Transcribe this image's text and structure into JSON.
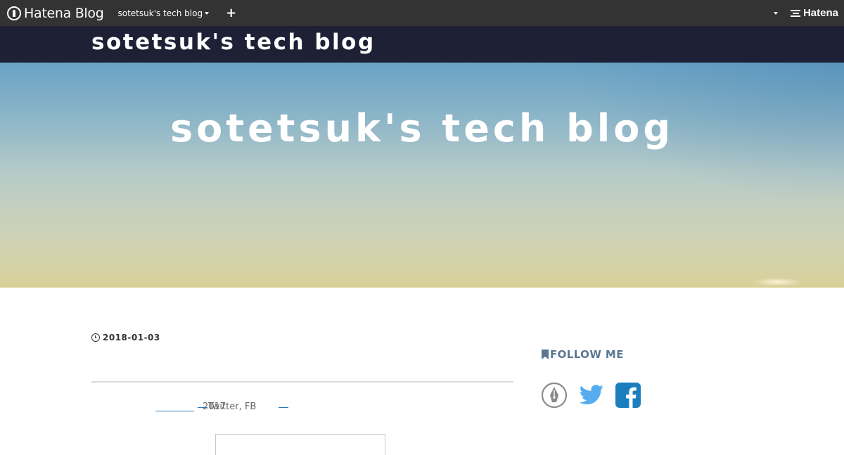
{
  "globalbar": {
    "logo_text": "Hatena Blog",
    "blog_name": "sotetsuk's tech blog",
    "add_label": "+",
    "brand": "Hatena"
  },
  "blog": {
    "title": "sotetsuk's tech blog"
  },
  "hero": {
    "title": "sotetsuk's tech blog"
  },
  "entry": {
    "date": "2018-01-03",
    "snippet_a": "2017",
    "snippet_b": "Twitter, FB"
  },
  "sidebar": {
    "follow_heading": "FOLLOW ME",
    "icons": [
      "hatena-pen-icon",
      "twitter-icon",
      "facebook-icon"
    ]
  },
  "colors": {
    "globalbar_bg": "#333333",
    "header_bg": "#1e2136",
    "accent": "#5a7793",
    "twitter": "#55acee",
    "facebook": "#1c7ebf"
  }
}
